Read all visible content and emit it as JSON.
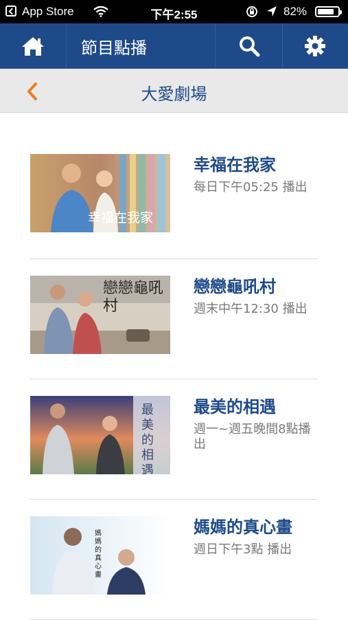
{
  "status_bar": {
    "back_app": "App Store",
    "time": "下午2:55",
    "battery": "82%",
    "battery_level": 0.82
  },
  "navbar": {
    "title": "節目點播",
    "icons": [
      "home-icon",
      "search-icon",
      "gear-icon"
    ]
  },
  "subheader": {
    "title": "大愛劇場"
  },
  "programs": [
    {
      "title": "幸福在我家",
      "schedule": "每日下午05:25 播出",
      "thumb_text": "幸福在我家"
    },
    {
      "title": "戀戀龜吼村",
      "schedule": "週末中午12:30 播出",
      "thumb_text": "戀戀龜吼村"
    },
    {
      "title": "最美的相遇",
      "schedule": "週一~週五晚間8點播出",
      "thumb_text": "最美的相遇"
    },
    {
      "title": "媽媽的真心畫",
      "schedule": "週日下午3點 播出",
      "thumb_text": "媽媽的真心畫"
    }
  ],
  "colors": {
    "navbar": "#1e4a8a",
    "accent_back": "#ef7d22",
    "title_text": "#1e4a8a",
    "schedule_text": "#7a7a7a"
  }
}
